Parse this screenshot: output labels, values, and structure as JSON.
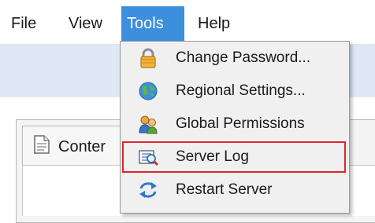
{
  "menubar": {
    "items": [
      {
        "label": "File"
      },
      {
        "label": "View"
      },
      {
        "label": "Tools",
        "active": true
      },
      {
        "label": "Help"
      }
    ]
  },
  "tab": {
    "label": "Conter"
  },
  "tools_menu": {
    "items": [
      {
        "label": "Change Password...",
        "icon": "lock-icon"
      },
      {
        "label": "Regional Settings...",
        "icon": "globe-icon"
      },
      {
        "label": "Global Permissions",
        "icon": "users-icon"
      },
      {
        "label": "Server Log",
        "icon": "log-search-icon",
        "highlighted": true
      },
      {
        "label": "Restart Server",
        "icon": "refresh-icon"
      }
    ]
  },
  "colors": {
    "menu_active": "#3c8fdd",
    "highlight_border": "#e0232a",
    "band": "#dfe8f5"
  }
}
